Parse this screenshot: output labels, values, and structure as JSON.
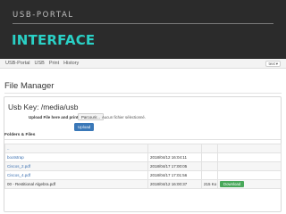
{
  "slide": {
    "eyebrow": "USB-PORTAL",
    "headline": "INTERFACE"
  },
  "nav": {
    "items": [
      "USB-Portal",
      "USB",
      "Print",
      "History"
    ],
    "language": "text",
    "language_caret": "▾"
  },
  "page": {
    "title": "File Manager"
  },
  "usb": {
    "title": "Usb Key: /media/usb",
    "upload_label": "Upload File here and print",
    "browse_label": "Parcourir...",
    "no_file_label": "Aucun fichier sélectionné.",
    "upload_button": "Upload",
    "folders_label": "Folders & Files"
  },
  "files": [
    {
      "name": "..",
      "date": "",
      "size": "",
      "action": "",
      "link": true
    },
    {
      "name": "bootstrap",
      "date": "2018/04/12 16:04:11",
      "size": "",
      "action": "",
      "link": true
    },
    {
      "name": "Ciscos_2.pdf",
      "date": "2018/04/17 17:00:05",
      "size": "",
      "action": "",
      "link": true
    },
    {
      "name": "Ciscos_4.pdf",
      "date": "2018/04/17 17:01:56",
      "size": "",
      "action": "",
      "link": true
    },
    {
      "name": "00 - Restitional Algebra.pdf",
      "date": "2018/04/12 16:00:37",
      "size": "215 Ko",
      "action": "Download",
      "link": false
    }
  ]
}
